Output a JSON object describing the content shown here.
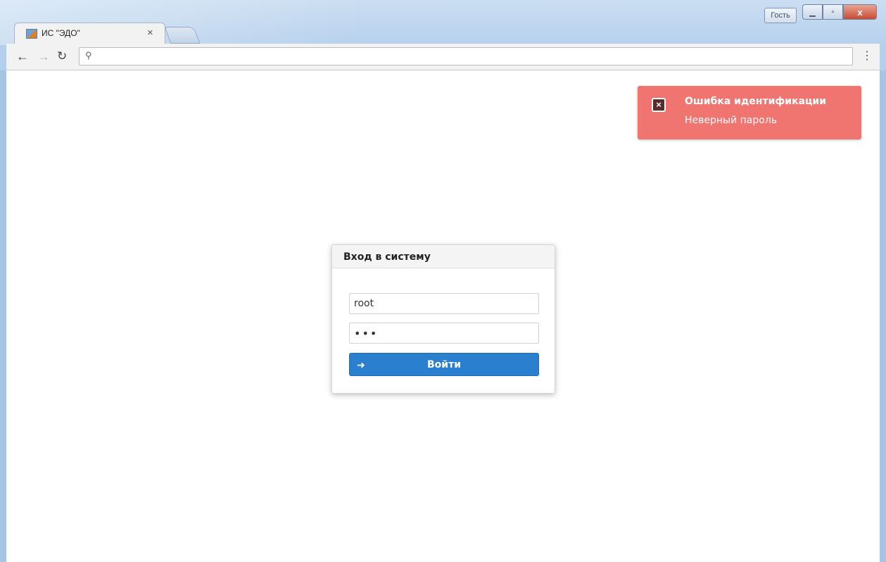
{
  "titlebar": {
    "guest_label": "Гость",
    "minimize_icon": "minimize-icon",
    "maximize_icon": "maximize-icon",
    "close_icon": "close-icon",
    "close_glyph": "x"
  },
  "tab": {
    "title": "ИС \"ЭДО\"",
    "close_glyph": "×"
  },
  "toolbar": {
    "url": "",
    "menu_glyph": "⋮"
  },
  "toast": {
    "title": "Ошибка идентификации",
    "message": "Неверный пароль",
    "color": "#f07470"
  },
  "login": {
    "title": "Вход в систему",
    "username": "root",
    "password": "•••",
    "button_label": "Войти",
    "button_color": "#2a80cf"
  }
}
